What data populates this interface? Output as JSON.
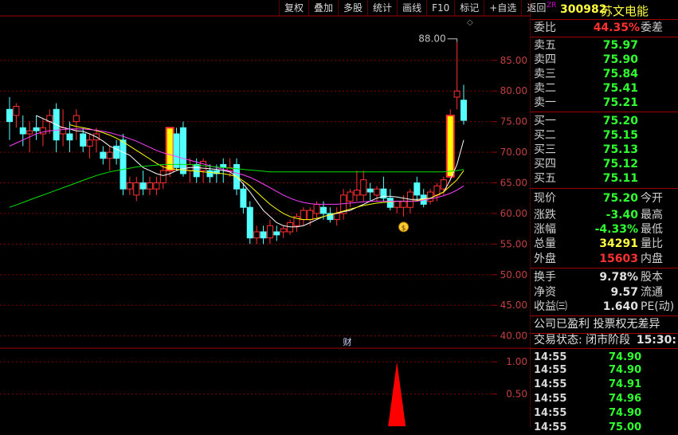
{
  "toolbar": [
    "复权",
    "叠加",
    "多股",
    "统计",
    "画线",
    "F10",
    "标记",
    "+自选",
    "返回"
  ],
  "stock": {
    "prefix": "ZR",
    "code": "300982",
    "name": "苏文电能"
  },
  "chart_data": [
    {
      "type": "candlestick",
      "title": "",
      "ylim": [
        38,
        92
      ],
      "yticks": [
        40.0,
        45.0,
        50.0,
        55.0,
        60.0,
        65.0,
        70.0,
        75.0,
        80.0,
        85.0
      ],
      "annotation": "88.00",
      "marker_label": "财",
      "candles": [
        {
          "o": 77,
          "h": 79,
          "l": 72,
          "c": 75
        },
        {
          "o": 76,
          "h": 78,
          "l": 74,
          "c": 77.5
        },
        {
          "o": 74,
          "h": 76,
          "l": 71,
          "c": 73
        },
        {
          "o": 73,
          "h": 75,
          "l": 70,
          "c": 73.5
        },
        {
          "o": 74,
          "h": 76,
          "l": 72,
          "c": 73.5
        },
        {
          "o": 73,
          "h": 75.5,
          "l": 71,
          "c": 74
        },
        {
          "o": 75,
          "h": 77,
          "l": 73,
          "c": 76
        },
        {
          "o": 77,
          "h": 78,
          "l": 70,
          "c": 72
        },
        {
          "o": 73,
          "h": 77,
          "l": 71,
          "c": 74
        },
        {
          "o": 73,
          "h": 75,
          "l": 70,
          "c": 72
        },
        {
          "o": 75,
          "h": 77,
          "l": 72,
          "c": 76
        },
        {
          "o": 73,
          "h": 74,
          "l": 70,
          "c": 71
        },
        {
          "o": 71,
          "h": 73,
          "l": 69,
          "c": 72
        },
        {
          "o": 72,
          "h": 74,
          "l": 70,
          "c": 73
        },
        {
          "o": 70,
          "h": 71,
          "l": 68,
          "c": 69
        },
        {
          "o": 69,
          "h": 71,
          "l": 67,
          "c": 70
        },
        {
          "o": 71,
          "h": 72,
          "l": 68,
          "c": 69
        },
        {
          "o": 72,
          "h": 73,
          "l": 63,
          "c": 64
        },
        {
          "o": 64,
          "h": 66,
          "l": 63,
          "c": 65
        },
        {
          "o": 63,
          "h": 66,
          "l": 62,
          "c": 65
        },
        {
          "o": 65,
          "h": 67,
          "l": 63,
          "c": 64
        },
        {
          "o": 64,
          "h": 66,
          "l": 63,
          "c": 65
        },
        {
          "o": 64,
          "h": 66,
          "l": 63,
          "c": 65
        },
        {
          "o": 65,
          "h": 68,
          "l": 64,
          "c": 67
        },
        {
          "o": 67,
          "h": 74,
          "l": 66,
          "c": 74
        },
        {
          "o": 73,
          "h": 74,
          "l": 67,
          "c": 67.5
        },
        {
          "o": 74,
          "h": 75,
          "l": 66,
          "c": 66.5
        },
        {
          "o": 67,
          "h": 69,
          "l": 65,
          "c": 68
        },
        {
          "o": 68,
          "h": 69,
          "l": 65,
          "c": 66
        },
        {
          "o": 67,
          "h": 69,
          "l": 65,
          "c": 68.5
        },
        {
          "o": 67,
          "h": 68,
          "l": 65,
          "c": 66
        },
        {
          "o": 67,
          "h": 68,
          "l": 65,
          "c": 66.5
        },
        {
          "o": 68,
          "h": 69,
          "l": 65,
          "c": 67.5
        },
        {
          "o": 67,
          "h": 69,
          "l": 66,
          "c": 67.5
        },
        {
          "o": 68,
          "h": 69,
          "l": 63,
          "c": 64
        },
        {
          "o": 64,
          "h": 65,
          "l": 60,
          "c": 61
        },
        {
          "o": 61,
          "h": 62,
          "l": 55,
          "c": 56
        },
        {
          "o": 56,
          "h": 58,
          "l": 55,
          "c": 57
        },
        {
          "o": 57,
          "h": 58,
          "l": 55,
          "c": 56
        },
        {
          "o": 56,
          "h": 59,
          "l": 55,
          "c": 58
        },
        {
          "o": 57,
          "h": 58,
          "l": 55.5,
          "c": 56.5
        },
        {
          "o": 57,
          "h": 58,
          "l": 56,
          "c": 57.5
        },
        {
          "o": 57,
          "h": 59,
          "l": 56.5,
          "c": 58.5
        },
        {
          "o": 58,
          "h": 60,
          "l": 57,
          "c": 59.5
        },
        {
          "o": 59,
          "h": 61,
          "l": 58,
          "c": 60.5
        },
        {
          "o": 59,
          "h": 61,
          "l": 58,
          "c": 60.5
        },
        {
          "o": 60,
          "h": 62,
          "l": 59,
          "c": 61.5
        },
        {
          "o": 61,
          "h": 62,
          "l": 59,
          "c": 60
        },
        {
          "o": 60,
          "h": 61,
          "l": 58.5,
          "c": 59
        },
        {
          "o": 59,
          "h": 61,
          "l": 58,
          "c": 60
        },
        {
          "o": 60,
          "h": 64,
          "l": 59,
          "c": 63
        },
        {
          "o": 62,
          "h": 64,
          "l": 61,
          "c": 63.5
        },
        {
          "o": 63,
          "h": 67,
          "l": 62,
          "c": 63.8
        },
        {
          "o": 63,
          "h": 67,
          "l": 62,
          "c": 65.5
        },
        {
          "o": 64,
          "h": 65,
          "l": 62,
          "c": 63.5
        },
        {
          "o": 63,
          "h": 64.5,
          "l": 62,
          "c": 64
        },
        {
          "o": 64,
          "h": 66,
          "l": 62,
          "c": 62.5
        },
        {
          "o": 62.5,
          "h": 64,
          "l": 60.5,
          "c": 61
        },
        {
          "o": 61,
          "h": 62,
          "l": 60,
          "c": 62
        },
        {
          "o": 61,
          "h": 63,
          "l": 59.5,
          "c": 62
        },
        {
          "o": 61,
          "h": 64,
          "l": 60,
          "c": 63.5
        },
        {
          "o": 65,
          "h": 66,
          "l": 62,
          "c": 63
        },
        {
          "o": 63,
          "h": 64,
          "l": 61,
          "c": 61.5
        },
        {
          "o": 62,
          "h": 64,
          "l": 61.5,
          "c": 63.5
        },
        {
          "o": 63,
          "h": 65,
          "l": 62,
          "c": 64.5
        },
        {
          "o": 64,
          "h": 66,
          "l": 63,
          "c": 65.5
        },
        {
          "o": 66,
          "h": 77,
          "l": 65.5,
          "c": 76
        },
        {
          "o": 79,
          "h": 88,
          "l": 77,
          "c": 80
        },
        {
          "o": 78.5,
          "h": 81,
          "l": 74.5,
          "c": 75.2
        }
      ],
      "limit_up_days": [
        24,
        66
      ],
      "ma_lines": [
        {
          "color": "#ffffff",
          "values": [
            null,
            null,
            null,
            null,
            76,
            75.5,
            75,
            74.5,
            74,
            73.8,
            73.5,
            73.4,
            73,
            72.5,
            71.8,
            71,
            70.5,
            70,
            69.5,
            68.5,
            67.5,
            67,
            66.5,
            66.2,
            66.5,
            67,
            67.3,
            67.5,
            67.5,
            67.4,
            67.3,
            67.2,
            67,
            66.8,
            66,
            64.8,
            63.5,
            62,
            60.5,
            59.5,
            58.5,
            58,
            57.8,
            57.8,
            58,
            58.5,
            59,
            59.5,
            59.8,
            60,
            60.3,
            60.5,
            61,
            61.5,
            62,
            62.5,
            62.8,
            62.8,
            62.7,
            62.5,
            62.3,
            62.3,
            62.4,
            62.5,
            63,
            63.5,
            65.5,
            68,
            72
          ]
        },
        {
          "color": "#ffff00",
          "values": [
            null,
            null,
            null,
            null,
            null,
            null,
            null,
            null,
            null,
            74.5,
            74.2,
            74,
            73.8,
            73.5,
            73.2,
            72.8,
            72.3,
            71.7,
            71,
            70.3,
            69.6,
            68.9,
            68.2,
            67.6,
            67.3,
            67.2,
            67.1,
            67,
            66.9,
            66.8,
            66.7,
            66.6,
            66.5,
            66.3,
            66,
            65.3,
            64.5,
            63.5,
            62.5,
            61.5,
            60.7,
            60,
            59.5,
            59.2,
            59,
            59,
            59.2,
            59.5,
            59.8,
            60.1,
            60.4,
            60.7,
            61,
            61.3,
            61.5,
            61.7,
            61.8,
            61.9,
            62,
            62,
            62,
            62.1,
            62.3,
            62.5,
            63,
            63.5,
            64.5,
            65.5,
            67
          ]
        },
        {
          "color": "#ff40ff",
          "values": [
            71,
            71.5,
            72,
            72.5,
            73,
            73.3,
            73.5,
            73.6,
            73.7,
            73.8,
            73.8,
            73.8,
            73.7,
            73.6,
            73.4,
            73.2,
            72.9,
            72.6,
            72.2,
            71.8,
            71.3,
            70.8,
            70.3,
            69.9,
            69.6,
            69.3,
            69,
            68.7,
            68.4,
            68.1,
            67.8,
            67.5,
            67.2,
            66.9,
            66.6,
            66.3,
            65.9,
            65.4,
            64.8,
            64.2,
            63.6,
            63,
            62.5,
            62.1,
            61.8,
            61.6,
            61.5,
            61.5,
            61.5,
            61.5,
            61.6,
            61.7,
            61.8,
            61.9,
            62,
            62,
            62,
            62,
            62,
            62,
            62,
            62,
            62.2,
            62.4,
            62.6,
            62.9,
            63.3,
            63.8,
            64.5
          ]
        },
        {
          "color": "#00e000",
          "values": [
            61,
            61.4,
            61.8,
            62.2,
            62.6,
            63,
            63.4,
            63.8,
            64.2,
            64.6,
            65,
            65.4,
            65.8,
            66.2,
            66.5,
            66.8,
            67,
            67.2,
            67.4,
            67.6,
            67.7,
            67.8,
            67.9,
            68,
            68,
            68,
            68,
            68,
            67.9,
            67.8,
            67.7,
            67.6,
            67.5,
            67.4,
            67.3,
            67.2,
            67.1,
            67,
            66.9,
            66.8,
            66.8,
            66.8,
            66.8,
            66.8,
            66.8,
            66.8,
            66.8,
            66.8,
            66.8,
            66.8,
            66.8,
            66.8,
            66.8,
            66.8,
            66.8,
            66.8,
            66.8,
            66.8,
            66.8,
            66.8,
            66.8,
            66.8,
            66.8,
            66.8,
            66.8,
            66.8,
            66.9,
            67,
            67.2
          ]
        }
      ]
    },
    {
      "type": "bar",
      "title": "",
      "ylim": [
        0,
        1.2
      ],
      "yticks": [
        0.5,
        1.0
      ],
      "spike_index": 58,
      "spike_value": 1.0
    }
  ],
  "quote": {
    "weibi": {
      "label": "委比",
      "value": "44.35%",
      "extra": "委差"
    },
    "asks": [
      {
        "label": "卖五",
        "price": "75.97"
      },
      {
        "label": "卖四",
        "price": "75.90"
      },
      {
        "label": "卖三",
        "price": "75.84"
      },
      {
        "label": "卖二",
        "price": "75.41"
      },
      {
        "label": "卖一",
        "price": "75.21"
      }
    ],
    "bids": [
      {
        "label": "买一",
        "price": "75.20"
      },
      {
        "label": "买二",
        "price": "75.15"
      },
      {
        "label": "买三",
        "price": "75.13"
      },
      {
        "label": "买四",
        "price": "75.12"
      },
      {
        "label": "买五",
        "price": "75.11"
      }
    ],
    "stats": [
      {
        "label": "现价",
        "value": "75.20",
        "label2": "今开",
        "color": "#30ff30"
      },
      {
        "label": "涨跌",
        "value": "-3.40",
        "label2": "最高",
        "color": "#30ff30"
      },
      {
        "label": "涨幅",
        "value": "-4.33%",
        "label2": "最低",
        "color": "#30ff30"
      },
      {
        "label": "总量",
        "value": "34291",
        "label2": "量比",
        "color": "#ffff40"
      },
      {
        "label": "外盘",
        "value": "15603",
        "label2": "内盘",
        "color": "#ff3030"
      }
    ],
    "fund": [
      {
        "label": "换手",
        "value": "9.78%",
        "label2": "股本"
      },
      {
        "label": "净资",
        "value": "9.57",
        "label2": "流通"
      },
      {
        "label": "收益㈢",
        "value": "1.640",
        "label2": "PE(动)"
      }
    ],
    "note1": "公司已盈利 投票权无差异",
    "note2": "交易状态: 闭市阶段",
    "note2_time": "15:30:",
    "ticks": [
      {
        "t": "14:55",
        "p": "74.90"
      },
      {
        "t": "14:55",
        "p": "74.90"
      },
      {
        "t": "14:55",
        "p": "74.91"
      },
      {
        "t": "14:55",
        "p": "74.96"
      },
      {
        "t": "14:55",
        "p": "74.90"
      },
      {
        "t": "14:55",
        "p": "75.00"
      }
    ]
  }
}
